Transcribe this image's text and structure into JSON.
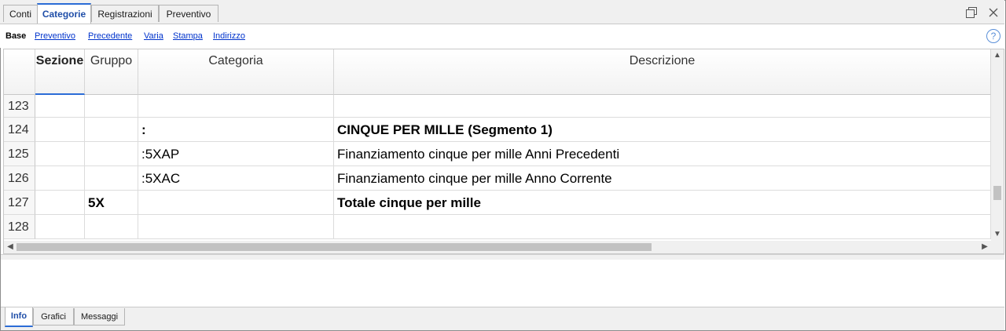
{
  "top_tabs": [
    {
      "label": "Conti"
    },
    {
      "label": "Categorie"
    },
    {
      "label": "Registrazioni"
    },
    {
      "label": "Preventivo"
    }
  ],
  "subnav": {
    "current": "Base",
    "links": [
      "Preventivo",
      "Precedente",
      "Varia",
      "Stampa",
      "Indirizzo"
    ]
  },
  "columns": [
    "Sezione",
    "Gruppo",
    "Categoria",
    "Descrizione"
  ],
  "rows": [
    {
      "num": "123",
      "sezione": "",
      "gruppo": "",
      "categoria": "",
      "descrizione": ""
    },
    {
      "num": "124",
      "sezione": "",
      "gruppo": "",
      "categoria": ":",
      "descrizione": "CINQUE PER MILLE (Segmento 1)"
    },
    {
      "num": "125",
      "sezione": "",
      "gruppo": "",
      "categoria": ":5XAP",
      "descrizione": "Finanziamento cinque per mille Anni Precedenti"
    },
    {
      "num": "126",
      "sezione": "",
      "gruppo": "",
      "categoria": ":5XAC",
      "descrizione": "Finanziamento cinque per mille Anno Corrente"
    },
    {
      "num": "127",
      "sezione": "",
      "gruppo": "5X",
      "categoria": "",
      "descrizione": "Totale cinque per mille"
    },
    {
      "num": "128",
      "sezione": "",
      "gruppo": "",
      "categoria": "",
      "descrizione": ""
    }
  ],
  "bottom_tabs": [
    {
      "label": "Info"
    },
    {
      "label": "Grafici"
    },
    {
      "label": "Messaggi"
    }
  ],
  "colors": {
    "accent": "#2b6cd6",
    "link": "#0033cc",
    "tab_active_text": "#1f4ea8"
  }
}
